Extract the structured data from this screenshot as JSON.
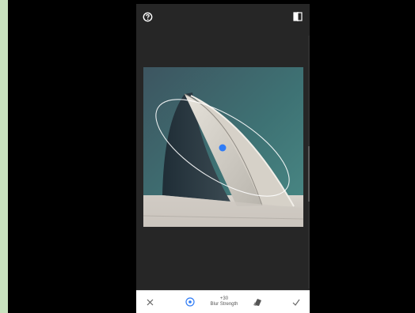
{
  "screen": {
    "background": "#262626",
    "accent": "#2f7cf6"
  },
  "top_bar": {
    "help_icon": "help-circle-icon",
    "compare_icon": "compare-split-icon"
  },
  "editor": {
    "tool": "lens-blur",
    "overlay": "elliptical-focus-ring",
    "focus_point_color": "#2f7cf6"
  },
  "bottom_bar": {
    "cancel_icon": "close-icon",
    "center_icon": "target-icon",
    "strength_value": "+30",
    "strength_label": "Blur Strength",
    "mask_icon": "eraser-icon",
    "apply_icon": "checkmark-icon"
  }
}
